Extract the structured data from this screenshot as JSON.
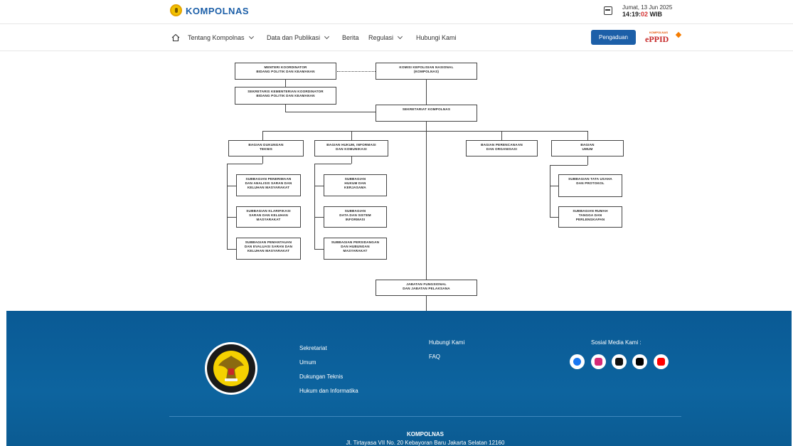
{
  "header": {
    "logo_text": "KOMPOLNAS",
    "date": "Jumat, 13 Jun 2025",
    "time_hm": "14:19:",
    "time_s": "02",
    "time_zone": " WIB"
  },
  "nav": {
    "items": [
      "Tentang Kompolnas",
      "Data dan Publikasi",
      "Berita",
      "Regulasi",
      "Hubungi Kami"
    ],
    "pengaduan_label": "Pengaduan",
    "eppid_small": "KOMPOLNAS",
    "eppid_big": "ePPID"
  },
  "org": {
    "menko": "Menteri Koordinator\nBidang Politik dan Keamanan",
    "kompolnas": "Komisi Kepolisian Nasional\n(KOMPOLNAS)",
    "sesmenko": "Sekretaris Kementerian Koordinator\nBidang Politik dan Keamanan",
    "sekretariat": "Sekretariat Kompolnas",
    "bagian_dukungan": "Bagian Dukungan\nTeknis",
    "bagian_hukum": "Bagian Hukum, Informasi\ndan Komunikasi",
    "bagian_perencanaan": "Bagian Perencanaan\ndan Organisasi",
    "bagian_umum": "Bagian\nUmum",
    "sub_dukungan": [
      "Subbagian Penerimaan\ndan Analisis Saran dan\nKeluhan Masyarakat",
      "Subbagian Klarifikasi\nSaran dan Keluhan\nMasyarakat",
      "Subbagian Pemantauan\ndan Evaluasi Saran dan\nKeluhan Masyarakat"
    ],
    "sub_hukum": [
      "Subbagian\nHukum dan\nKerjasama",
      "Subbagian\nData dan Sistem\nInformasi",
      "Subbagian Persidangan\ndan Hubungan\nMasyarakat"
    ],
    "sub_umum": [
      "Subbagian Tata Usaha\ndan Protokol",
      "Subbagian Rumah\nTangga dan\nPerlengkapan"
    ],
    "jabatan": "Jabatan Fungsional\ndan Jabatan Pelaksana"
  },
  "footer": {
    "col1": [
      "Sekretariat",
      "Umum",
      "Dukungan Teknis",
      "Hukum dan Informatika"
    ],
    "col2": [
      "Hubungi Kami",
      "FAQ"
    ],
    "social_title": "Sosial Media Kami :",
    "social_icons": [
      "facebook-icon",
      "instagram-icon",
      "tiktok-icon",
      "x-icon",
      "youtube-icon"
    ],
    "name": "KOMPOLNAS",
    "address": "Jl. Tirtayasa VII No. 20 Kebayoran Baru Jakarta Selatan 12160",
    "emblem_text": "KOMISI KEPOLISIAN NASIONAL"
  },
  "colors": {
    "primary": "#1c5fa8",
    "footer_bg": "#0d649f",
    "accent_red": "#d32f2f"
  }
}
